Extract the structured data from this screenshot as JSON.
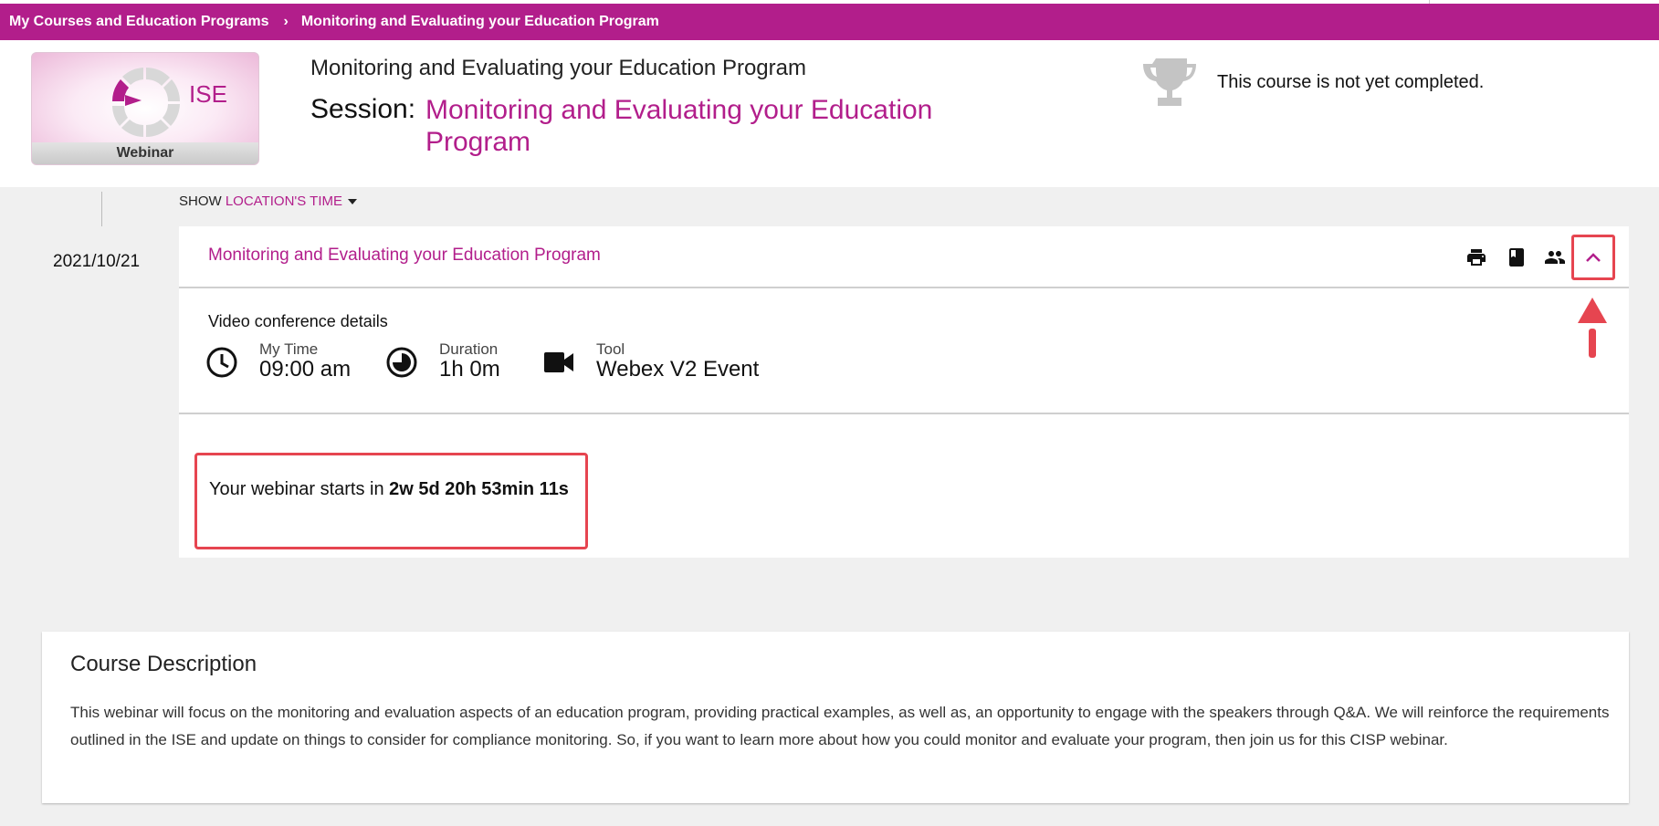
{
  "breadcrumb": {
    "root": "My Courses and Education Programs",
    "separator": "›",
    "current": "Monitoring and Evaluating your Education Program"
  },
  "header": {
    "thumbnail": {
      "badge_text": "ISE",
      "type_label": "Webinar"
    },
    "course_title": "Monitoring and Evaluating your Education Program",
    "session_label": "Session:",
    "session_name": "Monitoring and Evaluating your Education Program",
    "completion_status": "This course is not yet completed."
  },
  "timezone": {
    "show_label": "SHOW",
    "option_label": "LOCATION'S TIME"
  },
  "session": {
    "date": "2021/10/21",
    "title": "Monitoring and Evaluating your Education Program",
    "toolbar_icons": [
      "print-icon",
      "book-icon",
      "people-icon",
      "chevron-up-icon"
    ],
    "video_conference": {
      "heading": "Video conference details",
      "my_time_label": "My Time",
      "my_time_value": "09:00 am",
      "duration_label": "Duration",
      "duration_value": "1h 0m",
      "tool_label": "Tool",
      "tool_value": "Webex V2 Event"
    },
    "countdown_prefix": "Your webinar starts in",
    "countdown_value": "2w 5d 20h 53min 11s"
  },
  "course_description": {
    "heading": "Course Description",
    "text": "This webinar will focus on the monitoring and evaluation aspects of an education program, providing practical examples, as well as, an opportunity to engage with the speakers through Q&A. We will reinforce the requirements outlined in the ISE and update on things to consider for compliance monitoring. So, if you want to learn more about how you could monitor and evaluate your program, then join us for this CISP webinar."
  },
  "colors": {
    "brand": "#b21e8b",
    "highlight": "#e64550"
  }
}
